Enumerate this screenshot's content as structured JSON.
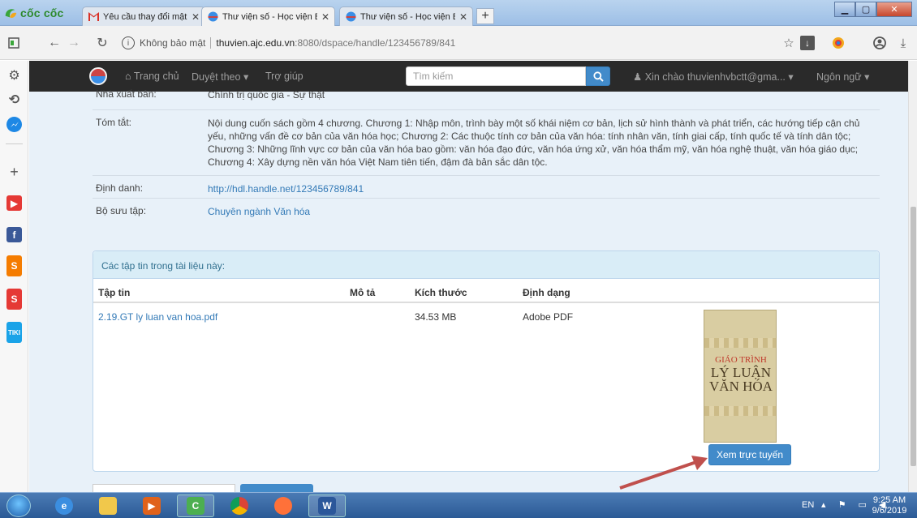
{
  "browser": {
    "brand": "cốc cốc",
    "tabs": [
      {
        "title": "Yêu cầu thay đổi mật khẩ",
        "icon": "gmail-icon"
      },
      {
        "title": "Thư viện số - Học viện Bá",
        "icon": "dspace-icon"
      },
      {
        "title": "Thư viện số - Học viện Bá",
        "icon": "dspace-icon"
      }
    ],
    "tab_close": "✕",
    "new_tab": "+",
    "security": "Không bảo mật",
    "url_host": "thuvien.ajc.edu.vn",
    "url_path": ":8080/dspace/handle/123456789/841"
  },
  "navbar": {
    "home": "Trang chủ",
    "browse": "Duyệt theo",
    "help": "Trợ giúp",
    "search_placeholder": "Tìm kiếm",
    "user": "Xin chào thuvienhvbctt@gma...",
    "language": "Ngôn ngữ"
  },
  "metadata": {
    "publisher_label": "Nhà xuất bản:",
    "publisher_value": "Chính trị quốc gia - Sự thật",
    "summary_label": "Tóm tắt:",
    "summary_value": "Nội dung cuốn sách gồm 4 chương. Chương 1: Nhập môn, trình bày một số khái niệm cơ bản, lịch sử hình thành và phát triển, các hướng tiếp cận chủ yếu, những vấn đề cơ bản của văn hóa học; Chương 2: Các thuộc tính cơ bản của văn hóa: tính nhân văn, tính giai cấp, tính quốc tế và tính dân tộc; Chương 3: Những lĩnh vực cơ bản của văn hóa bao gồm: văn hóa đạo đức, văn hóa ứng xử, văn hóa thẩm mỹ, văn hóa nghệ thuật, văn hóa giáo dục; Chương 4: Xây dựng nền văn hóa Việt Nam tiên tiến, đậm đà bản sắc dân tộc.",
    "identifier_label": "Định danh:",
    "identifier_value": "http://hdl.handle.net/123456789/841",
    "collection_label": "Bộ sưu tập:",
    "collection_value": "Chuyên ngành Văn hóa"
  },
  "files": {
    "heading": "Các tập tin trong tài liệu này:",
    "columns": [
      "Tập tin",
      "Mô tả",
      "Kích thước",
      "Định dạng"
    ],
    "rows": [
      {
        "file": "2.19.GT ly luan van hoa.pdf",
        "description": "",
        "size": "34.53 MB",
        "format": "Adobe PDF"
      }
    ],
    "thumbnail": {
      "subtitle": "GIÁO TRÌNH",
      "title": "LÝ LUẬN VĂN HÓA"
    },
    "view_button": "Xem trực tuyến"
  },
  "taskbar": {
    "language": "EN",
    "time": "9:25 AM",
    "date": "9/6/2019"
  },
  "colors": {
    "navbar_bg": "#2a2a2a",
    "page_bg": "#e8f1f9",
    "link": "#337ab7",
    "primary_button": "#428bca",
    "arrow": "#c0504d"
  }
}
